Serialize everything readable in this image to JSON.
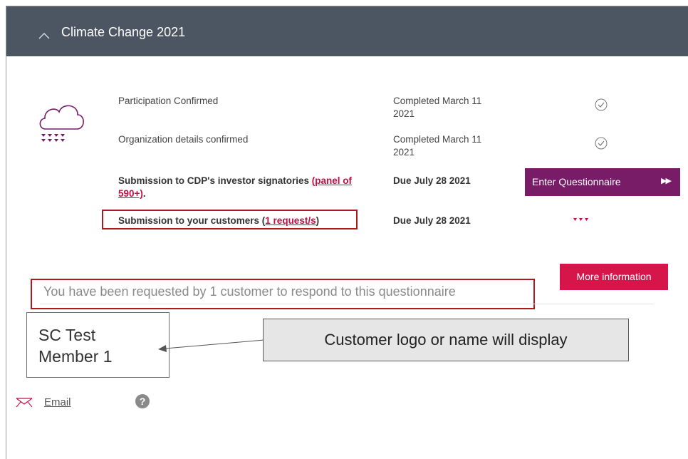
{
  "header": {
    "title": "Climate Change 2021"
  },
  "rows": [
    {
      "label": "Participation Confirmed",
      "status_line1": "Completed March 11",
      "status_line2": "2021"
    },
    {
      "label": "Organization details confirmed",
      "status_line1": "Completed March 11",
      "status_line2": "2021"
    },
    {
      "label": "Submission to CDP's investor signatories ",
      "link_line1": "(panel of",
      "link_line2": "590+)",
      "after": ".",
      "due": "Due July 28 2021"
    },
    {
      "label": "Submission to your customers (",
      "link": "1 request/s",
      "after": ")",
      "due": "Due July 28 2021"
    }
  ],
  "buttons": {
    "enter_questionnaire": "Enter Questionnaire",
    "more_information": "More information"
  },
  "requested_text": "You have been requested by 1 customer to respond to this questionnaire",
  "annotations": {
    "member_line1": "SC Test",
    "member_line2": "Member 1",
    "callout": "Customer logo or name will display"
  },
  "footer": {
    "email_label": "Email",
    "help": "?"
  },
  "icons": {
    "header": "chevron-up-icon",
    "topic": "cloud-rain-icon",
    "done": "check-circle-icon",
    "pending": "pending-dots-icon",
    "mail": "mail-icon",
    "help": "help-icon"
  }
}
